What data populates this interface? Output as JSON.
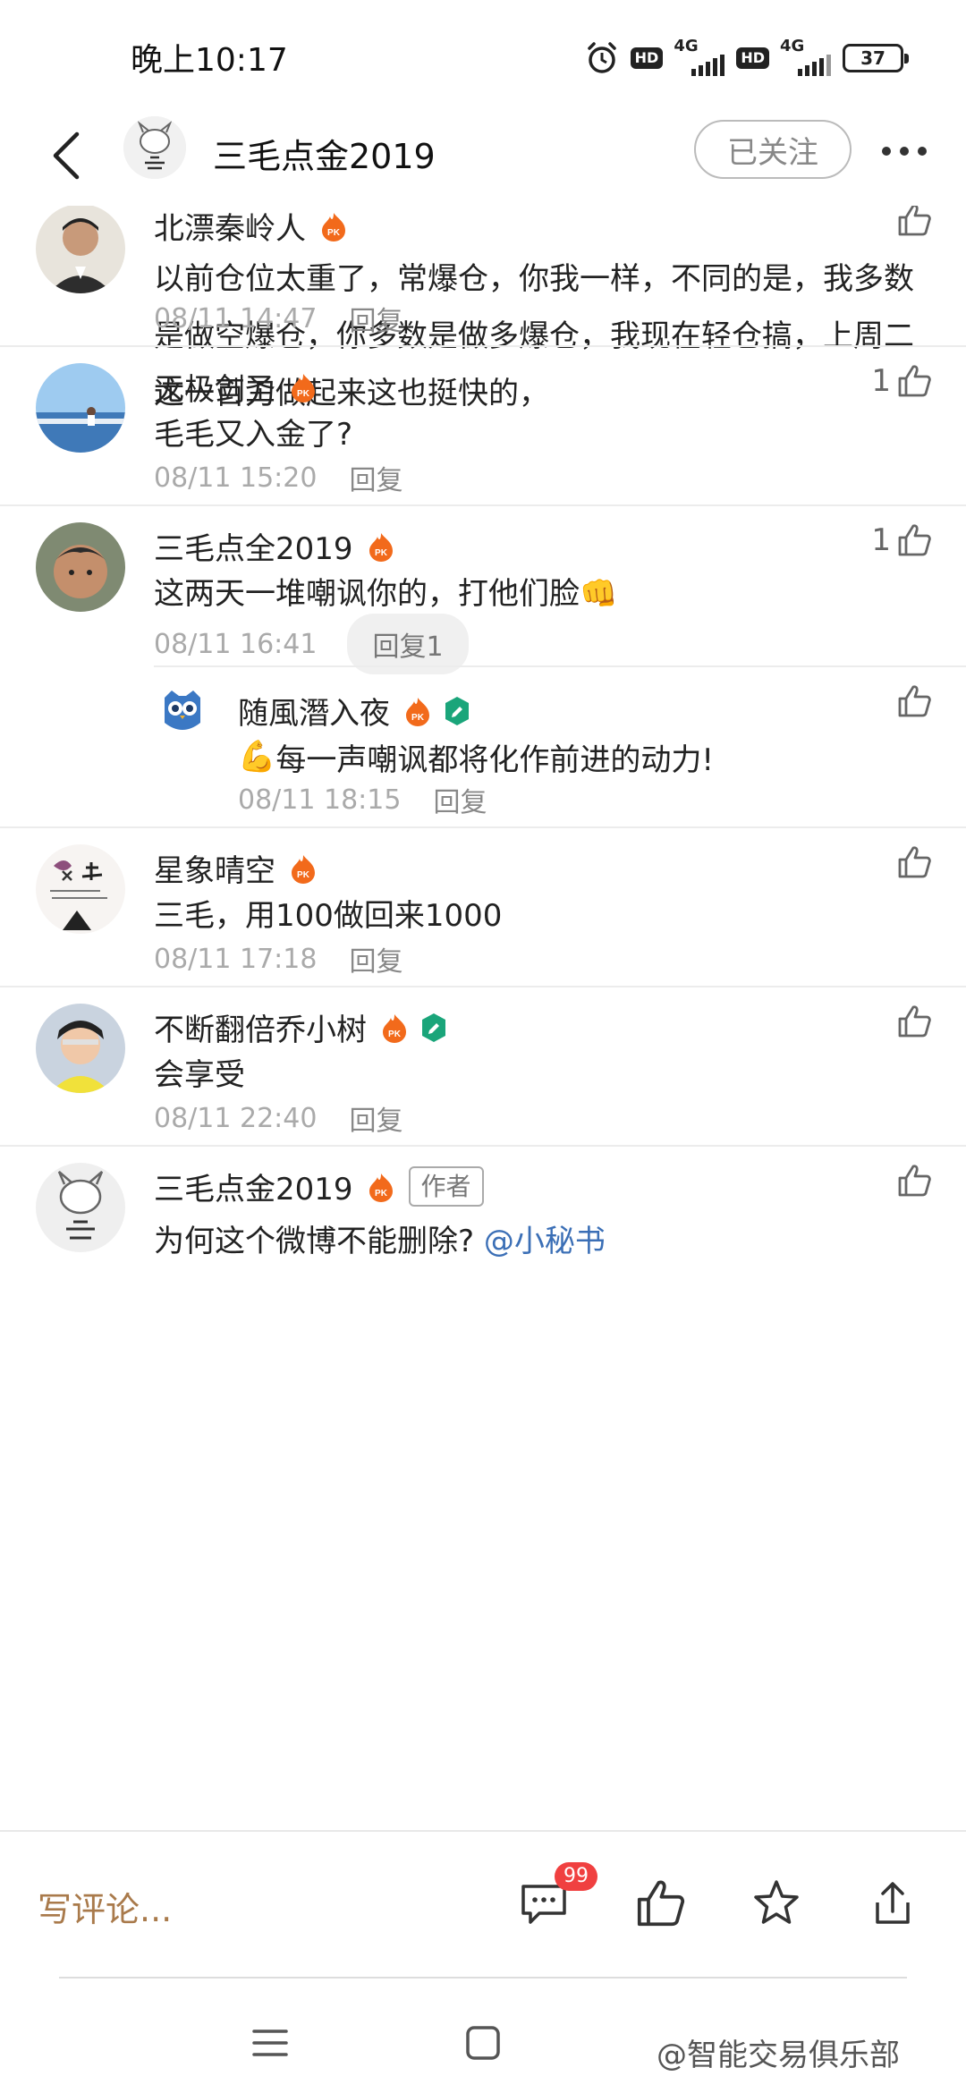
{
  "status_bar": {
    "time": "晚上10:17",
    "hd1": "HD",
    "net1": "4G",
    "hd2": "HD",
    "net2": "4G",
    "battery": "37"
  },
  "header": {
    "title": "三毛点金2019",
    "follow_label": "已关注"
  },
  "comments": [
    {
      "username": "北漂秦岭人",
      "text": "以前仓位太重了，常爆仓，你我一样，不同的是，我多数是做空爆仓，你多数是做多爆仓，我现在轻仓搞，上周二这一百刀做起来这也挺快的，",
      "time": "08/11 14:47",
      "reply_label": "回复",
      "likes": ""
    },
    {
      "username": "无极剑圣",
      "text": "毛毛又入金了?",
      "time": "08/11 15:20",
      "reply_label": "回复",
      "likes": "1"
    },
    {
      "username": "三毛点全2019",
      "text": "这两天一堆嘲讽你的，打他们脸",
      "emoji": "👊",
      "time": "08/11 16:41",
      "reply_label": "回复1",
      "likes": "1",
      "sub_reply": {
        "username": "随風潛入夜",
        "emoji": "💪",
        "text": "每一声嘲讽都将化作前进的动力!",
        "time": "08/11 18:15",
        "reply_label": "回复"
      }
    },
    {
      "username": "星象晴空",
      "text": "三毛，用100做回来1000",
      "time": "08/11 17:18",
      "reply_label": "回复",
      "likes": ""
    },
    {
      "username": "不断翻倍乔小树",
      "text": "会享受",
      "time": "08/11 22:40",
      "reply_label": "回复",
      "likes": ""
    },
    {
      "username": "三毛点金2019",
      "author_tag": "作者",
      "text": "为何这个微博不能删除?",
      "mention": "@小秘书",
      "likes": ""
    }
  ],
  "bottom_bar": {
    "write_comment": "写评论...",
    "comment_count": "99"
  },
  "watermark": "@智能交易俱乐部",
  "colors": {
    "accent_brown": "#a97a4b",
    "badge_red": "#f04040",
    "pk_orange": "#f26a1b",
    "verified_green": "#1aa57a"
  }
}
